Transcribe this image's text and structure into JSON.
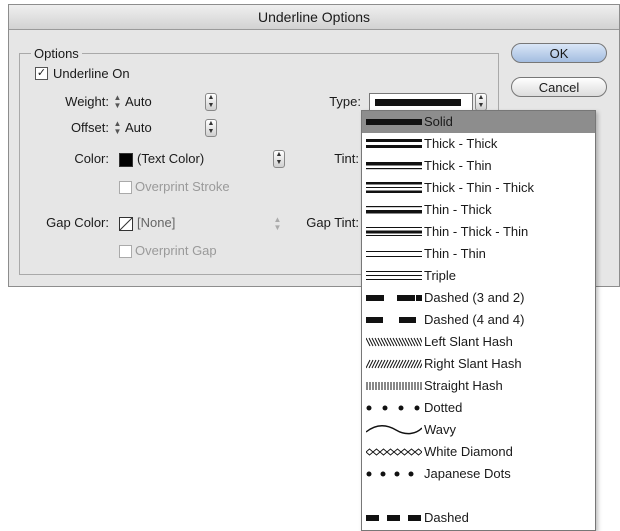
{
  "dialog": {
    "title": "Underline Options",
    "ok_label": "OK",
    "cancel_label": "Cancel"
  },
  "options": {
    "group_label": "Options",
    "underline_on_label": "Underline On",
    "underline_on_checked": true,
    "weight_label": "Weight:",
    "weight_value": "Auto",
    "offset_label": "Offset:",
    "offset_value": "Auto",
    "type_label": "Type:",
    "color_label": "Color:",
    "color_value": "(Text Color)",
    "tint_label": "Tint:",
    "overprint_stroke_label": "Overprint Stroke",
    "gap_color_label": "Gap Color:",
    "gap_color_value": "[None]",
    "gap_tint_label": "Gap Tint:",
    "overprint_gap_label": "Overprint Gap"
  },
  "type_menu": {
    "selected": "Solid",
    "items": [
      {
        "label": "Solid",
        "style": "solid"
      },
      {
        "label": "Thick - Thick",
        "style": "thick-thick"
      },
      {
        "label": "Thick - Thin",
        "style": "thick-thin"
      },
      {
        "label": "Thick - Thin - Thick",
        "style": "thick-thin-thick"
      },
      {
        "label": "Thin - Thick",
        "style": "thin-thick"
      },
      {
        "label": "Thin - Thick - Thin",
        "style": "thin-thick-thin"
      },
      {
        "label": "Thin - Thin",
        "style": "thin-thin"
      },
      {
        "label": "Triple",
        "style": "triple"
      },
      {
        "label": "Dashed (3 and 2)",
        "style": "dashed-3-2"
      },
      {
        "label": "Dashed (4 and 4)",
        "style": "dashed-4-4"
      },
      {
        "label": "Left Slant Hash",
        "style": "left-slant-hash"
      },
      {
        "label": "Right Slant Hash",
        "style": "right-slant-hash"
      },
      {
        "label": "Straight Hash",
        "style": "straight-hash"
      },
      {
        "label": "Dotted",
        "style": "dotted"
      },
      {
        "label": "Wavy",
        "style": "wavy"
      },
      {
        "label": "White Diamond",
        "style": "white-diamond"
      },
      {
        "label": "Japanese Dots",
        "style": "japanese-dots"
      },
      {
        "label": "",
        "style": "blank"
      },
      {
        "label": "Dashed",
        "style": "dashed"
      }
    ]
  }
}
